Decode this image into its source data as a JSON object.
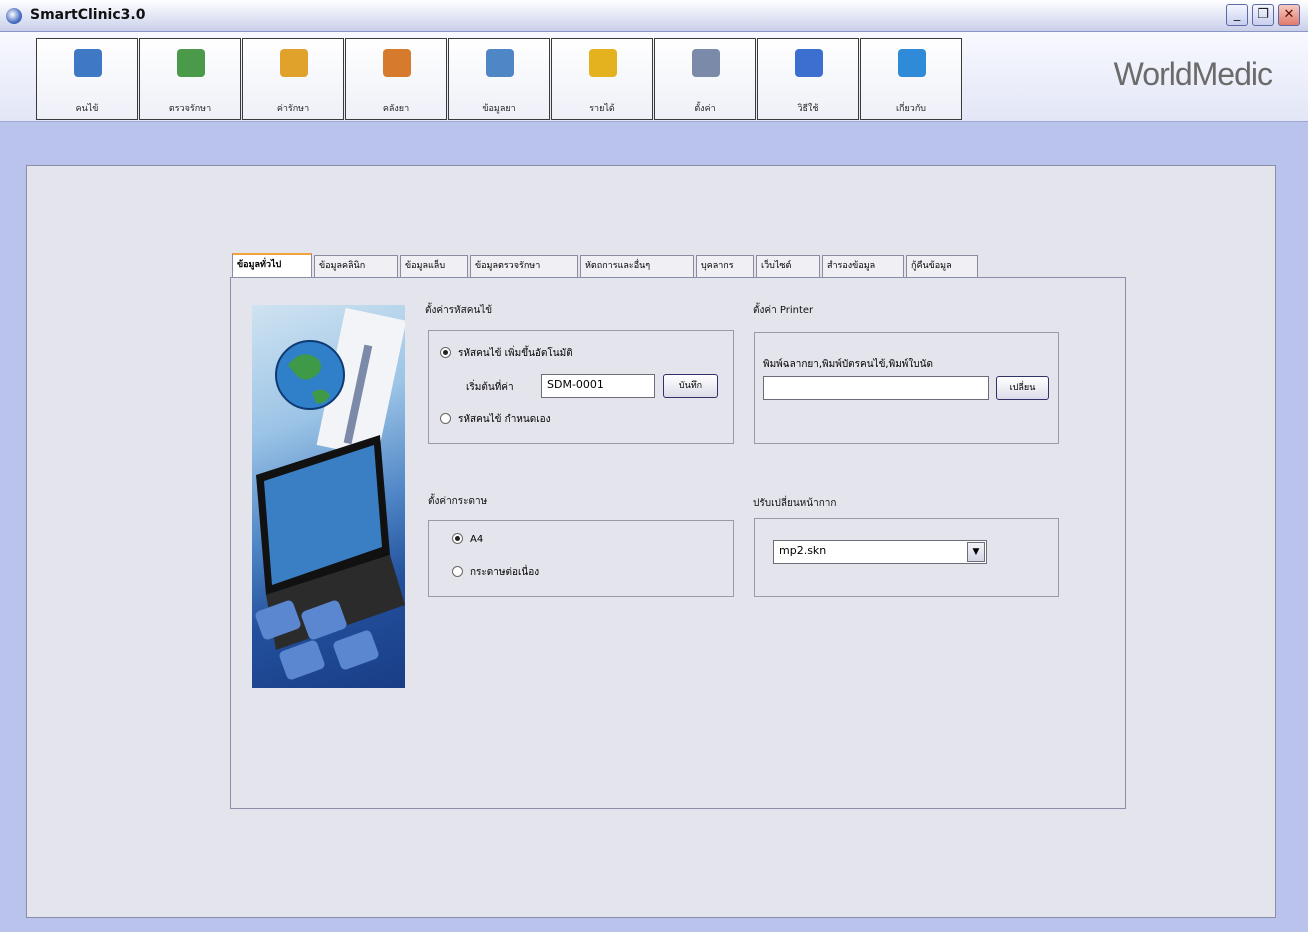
{
  "window": {
    "title": "SmartClinic3.0"
  },
  "toolbar": {
    "brand": "WorldMedic",
    "buttons": [
      {
        "label": "คนไข้",
        "icon": "folder-icon",
        "color": "#3f78c4"
      },
      {
        "label": "ตรวจรักษา",
        "icon": "people-icon",
        "color": "#4a9a4a"
      },
      {
        "label": "ค่ารักษา",
        "icon": "window-coins-icon",
        "color": "#e0a22a"
      },
      {
        "label": "คลังยา",
        "icon": "boxes-icon",
        "color": "#d67b2e"
      },
      {
        "label": "ข้อมูลยา",
        "icon": "pill-icon",
        "color": "#4f86c6"
      },
      {
        "label": "รายได้",
        "icon": "coins-icon",
        "color": "#e4b21e"
      },
      {
        "label": "ตั้งค่า",
        "icon": "tools-icon",
        "color": "#7a8aa8"
      },
      {
        "label": "วิธีใช้",
        "icon": "help-cursor-icon",
        "color": "#3c6fd0"
      },
      {
        "label": "เกี่ยวกับ",
        "icon": "about-icon",
        "color": "#2f8ad8"
      }
    ]
  },
  "tabs": [
    {
      "label": "ข้อมูลทั่วไป",
      "active": true
    },
    {
      "label": "ข้อมูลคลินิก"
    },
    {
      "label": "ข้อมูลแล็บ"
    },
    {
      "label": "ข้อมูลตรวจรักษา"
    },
    {
      "label": "หัตถการและอื่นๆ"
    },
    {
      "label": "บุคลากร"
    },
    {
      "label": "เว็บไซต์"
    },
    {
      "label": "สำรองข้อมูล"
    },
    {
      "label": "กู้คืนข้อมูล"
    }
  ],
  "patient_code": {
    "title": "ตั้งค่ารหัสคนไข้",
    "auto_label": "รหัสคนไข้ เพิ่มขึ้นอัตโนมัติ",
    "start_label": "เริ่มต้นที่ค่า",
    "start_value": "SDM-0001",
    "save_label": "บันทึก",
    "manual_label": "รหัสคนไข้ กำหนดเอง"
  },
  "printer": {
    "title": "ตั้งค่า Printer",
    "desc": "พิมพ์ฉลากยา,พิมพ์บัตรคนไข้,พิมพ์ใบนัด",
    "value": "",
    "change_label": "เปลี่ยน"
  },
  "paper": {
    "title": "ตั้งค่ากระดาษ",
    "a4_label": "A4",
    "continuous_label": "กระดาษต่อเนื่อง"
  },
  "skin": {
    "title": "ปรับเปลี่ยนหน้ากาก",
    "selected": "mp2.skn"
  }
}
